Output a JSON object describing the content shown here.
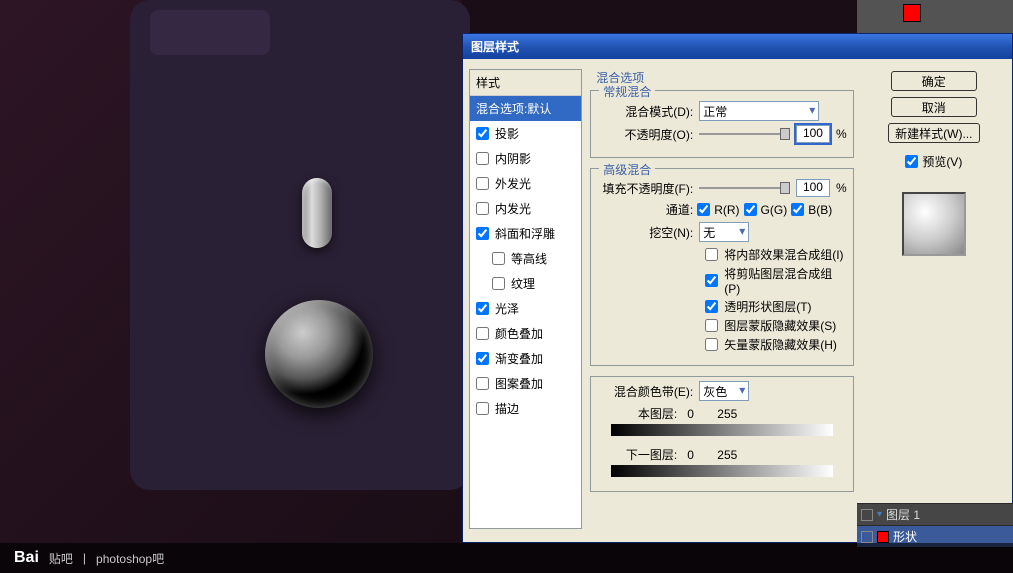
{
  "watermark": {
    "logo": "Bai",
    "sub": "贴吧",
    "sep": "|",
    "text": "photoshop吧"
  },
  "side_panel": {
    "layer1": "图层 1",
    "shape": "形状"
  },
  "dialog": {
    "title": "图层样式",
    "styles": {
      "header": "样式",
      "blend_default": "混合选项:默认",
      "items": [
        {
          "label": "投影",
          "checked": true
        },
        {
          "label": "内阴影",
          "checked": false
        },
        {
          "label": "外发光",
          "checked": false
        },
        {
          "label": "内发光",
          "checked": false
        },
        {
          "label": "斜面和浮雕",
          "checked": true,
          "subs": [
            {
              "label": "等高线",
              "checked": false
            },
            {
              "label": "纹理",
              "checked": false
            }
          ]
        },
        {
          "label": "光泽",
          "checked": true
        },
        {
          "label": "颜色叠加",
          "checked": false
        },
        {
          "label": "渐变叠加",
          "checked": true
        },
        {
          "label": "图案叠加",
          "checked": false
        },
        {
          "label": "描边",
          "checked": false
        }
      ]
    },
    "blend_options": {
      "group_title": "混合选项",
      "general": {
        "title": "常规混合",
        "mode_label": "混合模式(D):",
        "mode_value": "正常",
        "opacity_label": "不透明度(O):",
        "opacity_value": "100",
        "unit": "%"
      },
      "advanced": {
        "title": "高级混合",
        "fill_opacity_label": "填充不透明度(F):",
        "fill_opacity_value": "100",
        "unit": "%",
        "channels_label": "通道:",
        "ch_r": "R(R)",
        "ch_g": "G(G)",
        "ch_b": "B(B)",
        "knockout_label": "挖空(N):",
        "knockout_value": "无",
        "opts": [
          {
            "label": "将内部效果混合成组(I)",
            "checked": false
          },
          {
            "label": "将剪贴图层混合成组(P)",
            "checked": true
          },
          {
            "label": "透明形状图层(T)",
            "checked": true
          },
          {
            "label": "图层蒙版隐藏效果(S)",
            "checked": false
          },
          {
            "label": "矢量蒙版隐藏效果(H)",
            "checked": false
          }
        ]
      },
      "blend_if": {
        "title_label": "混合颜色带(E):",
        "value": "灰色",
        "this_layer": "本图层:",
        "this_min": "0",
        "this_max": "255",
        "under_layer": "下一图层:",
        "under_min": "0",
        "under_max": "255"
      }
    },
    "buttons": {
      "ok": "确定",
      "cancel": "取消",
      "new_style": "新建样式(W)...",
      "preview": "预览(V)"
    }
  }
}
